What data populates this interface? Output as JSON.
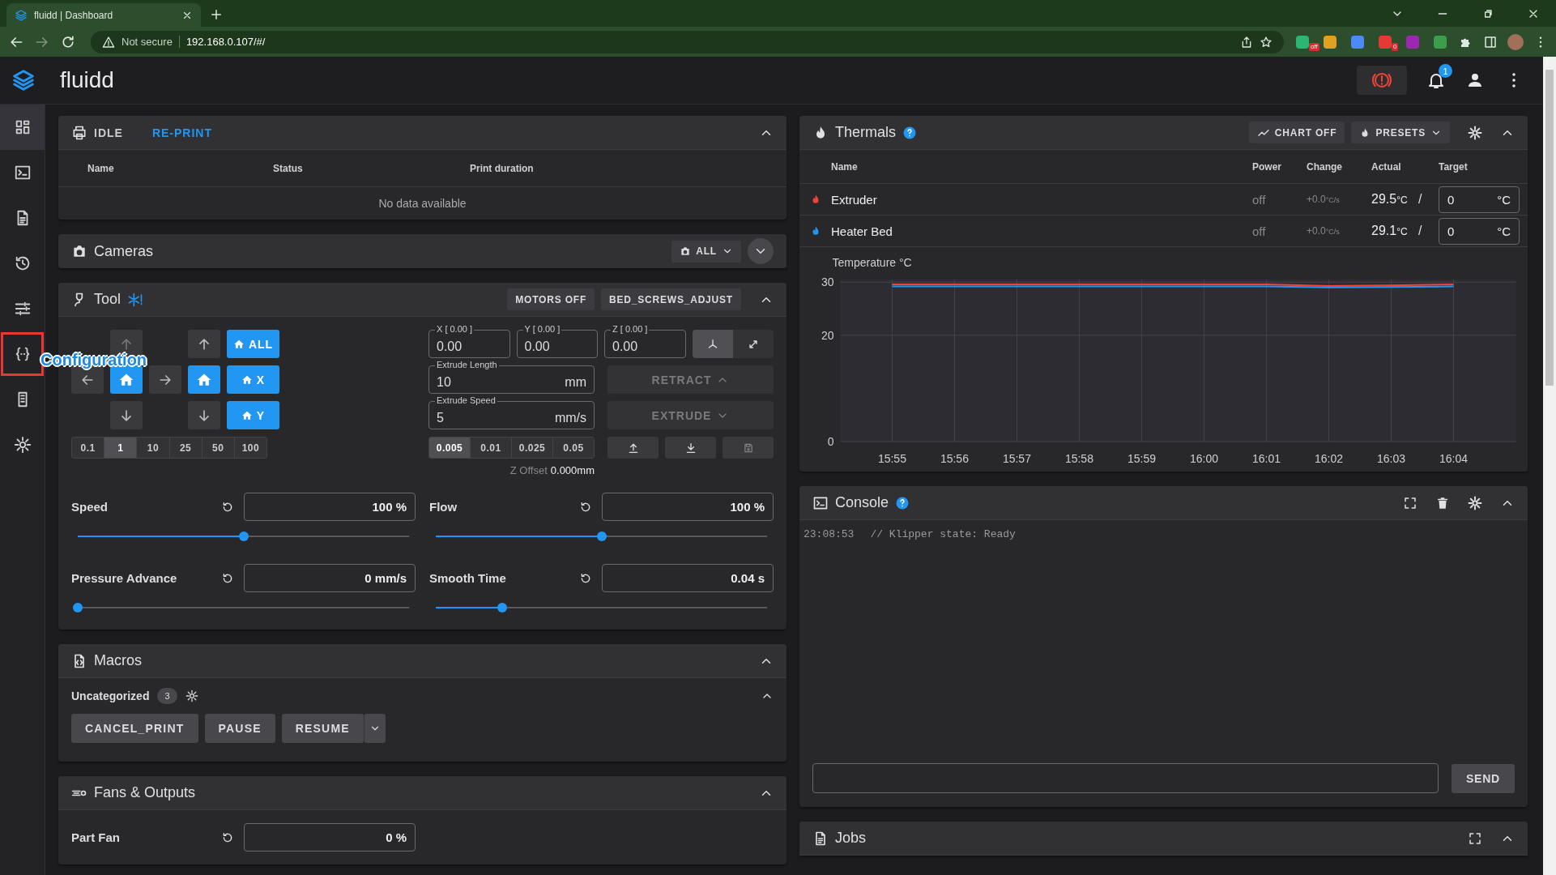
{
  "browser": {
    "tab_title": "fluidd | Dashboard",
    "security": "Not secure",
    "url": "192.168.0.107/#/",
    "extensions": [
      {
        "color": "#2bb673",
        "badge": "off"
      },
      {
        "color": "#e0a020"
      },
      {
        "color": "#4c8bf5"
      },
      {
        "color": "#e53935",
        "badge": "0"
      },
      {
        "color": "#9c27b0"
      },
      {
        "color": "#3c9d4a"
      }
    ]
  },
  "app": {
    "title": "fluidd",
    "notifications": "1"
  },
  "sidebar": {
    "items": [
      {
        "kind": "dashboard",
        "selected": true,
        "highlighted": false
      },
      {
        "kind": "console",
        "selected": false,
        "highlighted": false
      },
      {
        "kind": "jobs",
        "selected": false,
        "highlighted": false
      },
      {
        "kind": "history",
        "selected": false,
        "highlighted": false
      },
      {
        "kind": "tune",
        "selected": false,
        "highlighted": false
      },
      {
        "kind": "configuration",
        "selected": false,
        "highlighted": true,
        "tooltip": "Configuration"
      },
      {
        "kind": "system",
        "selected": false,
        "highlighted": false
      },
      {
        "kind": "settings",
        "selected": false,
        "highlighted": false
      }
    ]
  },
  "status": {
    "state": "IDLE",
    "reprint": "RE-PRINT",
    "columns": [
      "Name",
      "Status",
      "Print duration"
    ],
    "empty": "No data available"
  },
  "cameras": {
    "title": "Cameras",
    "filter": "ALL"
  },
  "tool": {
    "title": "Tool",
    "buttons": [
      "MOTORS OFF",
      "BED_SCREWS_ADJUST"
    ],
    "home_buttons": [
      "ALL",
      "X",
      "Y"
    ],
    "steps": [
      {
        "label": "0.1",
        "selected": false
      },
      {
        "label": "1",
        "selected": true
      },
      {
        "label": "10",
        "selected": false
      },
      {
        "label": "25",
        "selected": false
      },
      {
        "label": "50",
        "selected": false
      },
      {
        "label": "100",
        "selected": false
      }
    ],
    "positions": [
      {
        "label": "X [ 0.00 ]",
        "value": "0.00"
      },
      {
        "label": "Y [ 0.00 ]",
        "value": "0.00"
      },
      {
        "label": "Z [ 0.00 ]",
        "value": "0.00"
      }
    ],
    "modes": [
      {
        "kind": "axes",
        "selected": true
      },
      {
        "kind": "diagonal",
        "selected": false
      }
    ],
    "extrude_fields": [
      {
        "label": "Extrude Length",
        "value": "10",
        "unit": "mm"
      },
      {
        "label": "Extrude Speed",
        "value": "5",
        "unit": "mm/s"
      }
    ],
    "extrude_buttons": [
      {
        "label": "RETRACT",
        "kind": "retract",
        "disabled": true
      },
      {
        "label": "EXTRUDE",
        "kind": "extrude",
        "disabled": true
      }
    ],
    "z_steps": [
      {
        "label": "0.005",
        "selected": true
      },
      {
        "label": "0.01",
        "selected": false
      },
      {
        "label": "0.025",
        "selected": false
      },
      {
        "label": "0.05",
        "selected": false
      }
    ],
    "z_offset": {
      "label": "Z Offset",
      "value": "0.000mm"
    },
    "sliders": [
      {
        "label": "Speed",
        "value": "100 %",
        "level": 0.5
      },
      {
        "label": "Flow",
        "value": "100 %",
        "level": 0.5
      },
      {
        "label": "Pressure Advance",
        "value": "0 mm/s",
        "level": 0
      },
      {
        "label": "Smooth Time",
        "value": "0.04 s",
        "level": 0.2
      }
    ]
  },
  "macros": {
    "title": "Macros",
    "category": "Uncategorized",
    "count": "3",
    "buttons": [
      "CANCEL_PRINT",
      "PAUSE",
      "RESUME"
    ]
  },
  "fans": {
    "title": "Fans & Outputs",
    "items": [
      {
        "label": "Part Fan",
        "value": "0 %"
      }
    ]
  },
  "thermals": {
    "title": "Thermals",
    "buttons": [
      "CHART OFF",
      "PRESETS"
    ],
    "columns": [
      "Name",
      "Power",
      "Change",
      "Actual",
      "Target"
    ],
    "rows": [
      {
        "name": "Extruder",
        "color": "#f44336",
        "power": "off",
        "change": "+0.0",
        "change_unit": "°C/s",
        "actual": "29.5",
        "actual_unit": "°C",
        "separator": "/",
        "target": "0",
        "target_unit": "°C"
      },
      {
        "name": "Heater Bed",
        "color": "#2196f3",
        "power": "off",
        "change": "+0.0",
        "change_unit": "°C/s",
        "actual": "29.1",
        "actual_unit": "°C",
        "separator": "/",
        "target": "0",
        "target_unit": "°C"
      }
    ],
    "chart_data": {
      "type": "line",
      "ylabel": "Temperature °C",
      "categories": [
        "15:55",
        "15:56",
        "15:57",
        "15:58",
        "15:59",
        "16:00",
        "16:01",
        "16:02",
        "16:03",
        "16:04"
      ],
      "ylim": [
        0,
        30.5
      ],
      "yticks": [
        0,
        20,
        30
      ],
      "grid": true,
      "series": [
        {
          "color": "#f44336",
          "values": [
            29.6,
            29.6,
            29.6,
            29.6,
            29.6,
            29.6,
            29.6,
            29.3,
            29.4,
            29.6
          ]
        },
        {
          "color": "#2196f3",
          "values": [
            29.2,
            29.2,
            29.2,
            29.2,
            29.2,
            29.2,
            29.2,
            29.0,
            29.1,
            29.2
          ]
        }
      ]
    }
  },
  "console": {
    "title": "Console",
    "lines": [
      {
        "time": "23:08:53",
        "message": "// Klipper state: Ready"
      }
    ],
    "send": "SEND"
  },
  "jobs": {
    "title": "Jobs"
  }
}
